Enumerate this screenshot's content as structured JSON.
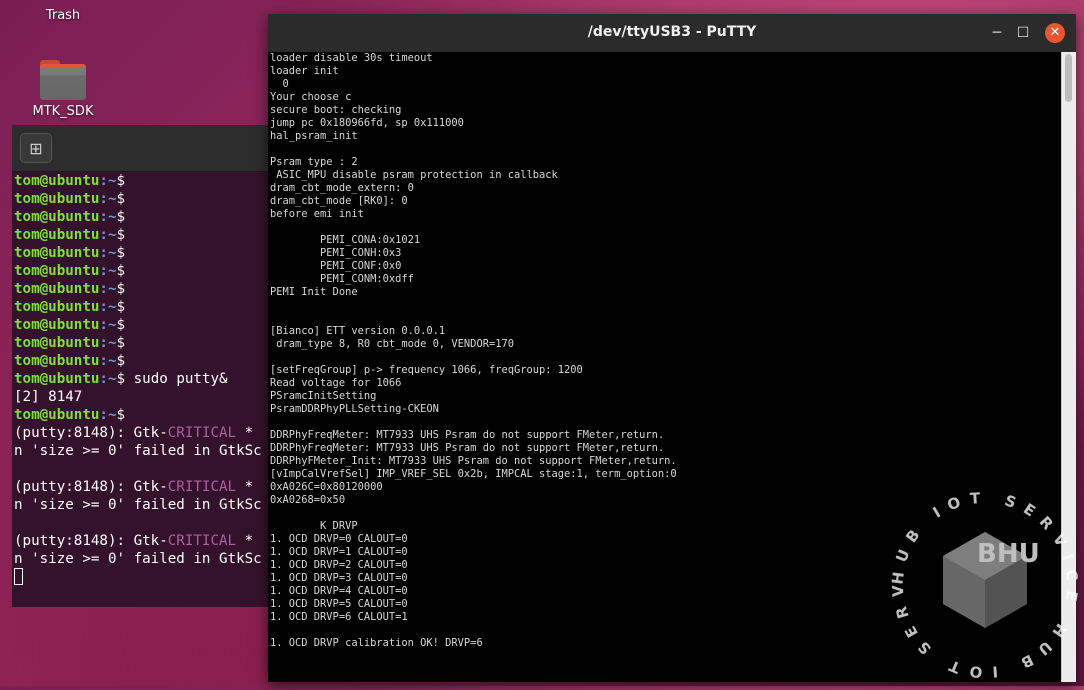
{
  "desktop": {
    "icons": [
      {
        "label": "Trash",
        "icon": "trash-icon"
      },
      {
        "label": "MTK_SDK",
        "icon": "folder-icon"
      }
    ]
  },
  "gnome_terminal": {
    "new_tab_icon": "new-tab-icon",
    "user": "tom@ubuntu",
    "path": ":~",
    "prompt_symbol": "$",
    "blank_prompts": 11,
    "command": "sudo putty&",
    "job_output": "[2] 8147",
    "errors": [
      {
        "prefix": "(putty:8148): Gtk-",
        "level": "CRITICAL",
        "rest": " *",
        "line2": "n 'size >= 0' failed in GtkSc"
      },
      {
        "prefix": "(putty:8148): Gtk-",
        "level": "CRITICAL",
        "rest": " *",
        "line2": "n 'size >= 0' failed in GtkSc"
      },
      {
        "prefix": "(putty:8148): Gtk-",
        "level": "CRITICAL",
        "rest": " *",
        "line2": "n 'size >= 0' failed in GtkSc"
      }
    ]
  },
  "putty": {
    "title": "/dev/ttyUSB3 - PuTTY",
    "minimize": "─",
    "maximize": "☐",
    "close": "✕",
    "lines": [
      "loader disable 30s timeout",
      "loader init",
      "  0",
      "Your choose c",
      "secure boot: checking",
      "jump pc 0x180966fd, sp 0x111000",
      "hal_psram_init",
      "",
      "Psram type : 2",
      " ASIC_MPU disable psram protection in callback",
      "dram_cbt_mode_extern: 0",
      "dram_cbt_mode [RK0]: 0",
      "before emi init",
      "",
      "        PEMI_CONA:0x1021",
      "        PEMI_CONH:0x3",
      "        PEMI_CONF:0x0",
      "        PEMI_CONM:0xdff",
      "PEMI Init Done",
      "",
      "",
      "[Bianco] ETT version 0.0.0.1",
      " dram_type 8, R0 cbt_mode 0, VENDOR=170",
      "",
      "[setFreqGroup] p-> frequency 1066, freqGroup: 1200",
      "Read voltage for 1066",
      "PSramcInitSetting",
      "PsramDDRPhyPLLSetting-CKEON",
      "",
      "DDRPhyFreqMeter: MT7933 UHS Psram do not support FMeter,return.",
      "DDRPhyFreqMeter: MT7933 UHS Psram do not support FMeter,return.",
      "DDRPhyFMeter_Init: MT7933 UHS Psram do not support FMeter,return.",
      "[vImpCalVrefSel] IMP_VREF_SEL 0x2b, IMPCAL stage:1, term_option:0",
      "0xA026C=0x80120000",
      "0xA0268=0x50",
      "",
      "        K DRVP",
      "1. OCD DRVP=0 CALOUT=0",
      "1. OCD DRVP=1 CALOUT=0",
      "1. OCD DRVP=2 CALOUT=0",
      "1. OCD DRVP=3 CALOUT=0",
      "1. OCD DRVP=4 CALOUT=0",
      "1. OCD DRVP=5 CALOUT=0",
      "1. OCD DRVP=6 CALOUT=1",
      "",
      "1. OCD DRVP calibration OK! DRVP=6"
    ]
  },
  "watermark": {
    "ring_text": "HUB IOT SERVICE HUB IOT SERVICE",
    "letters": "BHU"
  }
}
